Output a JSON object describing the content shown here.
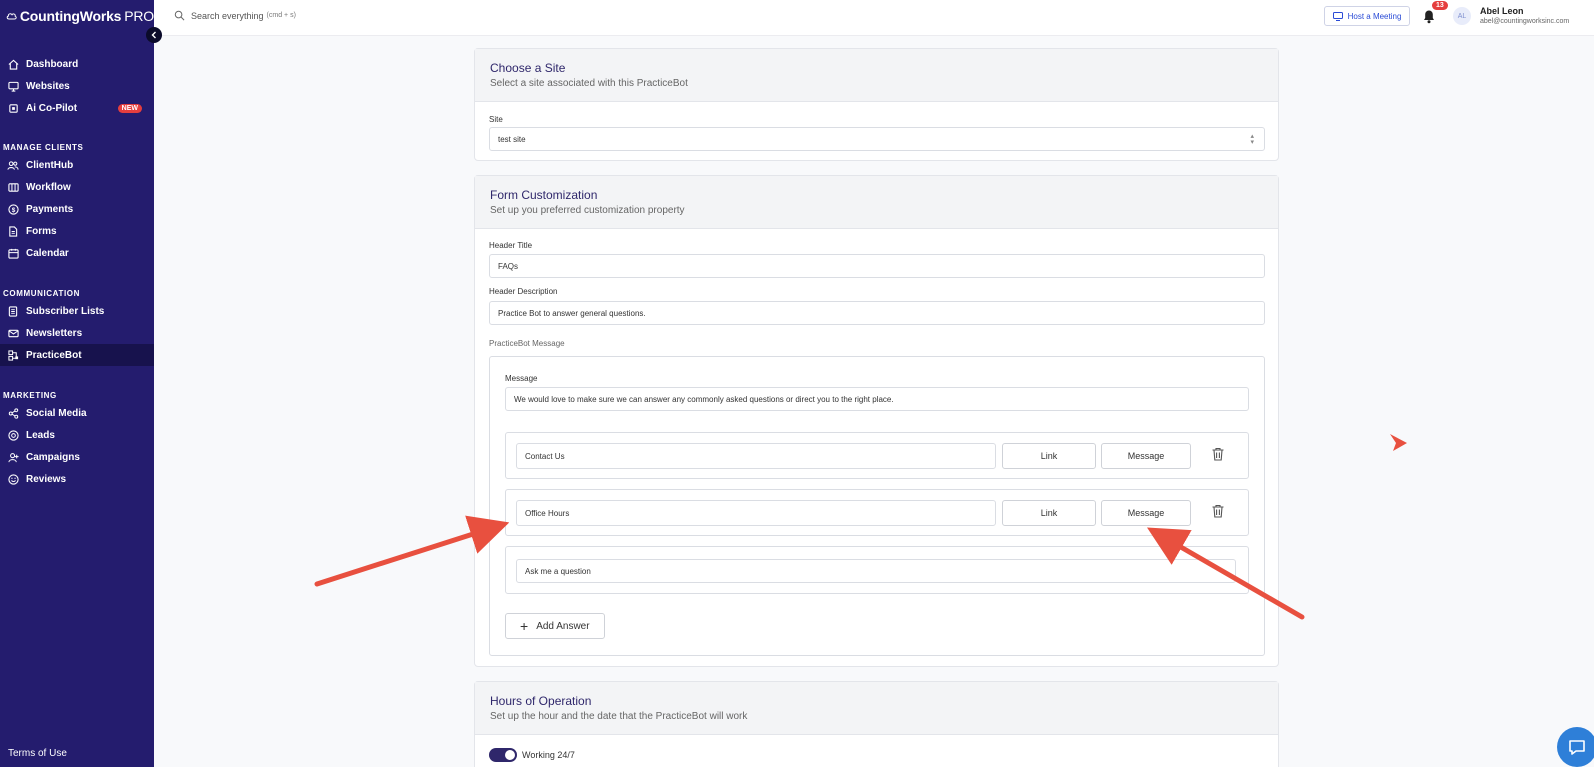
{
  "brand": {
    "name": "CountingWorks",
    "suffix": "PRO"
  },
  "sidebar": {
    "main": [
      {
        "label": "Dashboard",
        "icon": "home-icon"
      },
      {
        "label": "Websites",
        "icon": "monitor-icon"
      },
      {
        "label": "Ai Co-Pilot",
        "icon": "chip-icon",
        "badge": "NEW"
      }
    ],
    "sections": {
      "manage": "MANAGE CLIENTS",
      "communication": "COMMUNICATION",
      "marketing": "MARKETING"
    },
    "manage_items": [
      {
        "label": "ClientHub",
        "icon": "users-icon"
      },
      {
        "label": "Workflow",
        "icon": "columns-icon"
      },
      {
        "label": "Payments",
        "icon": "dollar-icon"
      },
      {
        "label": "Forms",
        "icon": "document-icon"
      },
      {
        "label": "Calendar",
        "icon": "calendar-icon"
      }
    ],
    "communication_items": [
      {
        "label": "Subscriber Lists",
        "icon": "list-icon"
      },
      {
        "label": "Newsletters",
        "icon": "mail-icon"
      },
      {
        "label": "PracticeBot",
        "icon": "bot-icon",
        "active": true
      }
    ],
    "marketing_items": [
      {
        "label": "Social Media",
        "icon": "share-icon"
      },
      {
        "label": "Leads",
        "icon": "at-icon"
      },
      {
        "label": "Campaigns",
        "icon": "user-plus-icon"
      },
      {
        "label": "Reviews",
        "icon": "smile-icon"
      }
    ],
    "footer": "Terms of Use"
  },
  "topbar": {
    "search_text": "Search everything",
    "search_hint": "(cmd + s)",
    "host_meeting": "Host a Meeting",
    "notification_count": "13",
    "avatar_initials": "AL",
    "user_name": "Abel Leon",
    "user_email": "abel@countingworksinc.com"
  },
  "site_card": {
    "title": "Choose a Site",
    "subtitle": "Select a site associated with this PracticeBot",
    "site_label": "Site",
    "site_value": "test site"
  },
  "form_card": {
    "title": "Form Customization",
    "subtitle": "Set up you preferred customization property",
    "header_title_label": "Header Title",
    "header_title_value": "FAQs",
    "header_desc_label": "Header Description",
    "header_desc_value": "Practice Bot to answer general questions.",
    "bot_message_label": "PracticeBot Message",
    "message_label": "Message",
    "message_value": "We would love to make sure we can answer any commonly asked questions or direct you to the right place.",
    "answers": [
      {
        "value": "Contact Us",
        "link": "Link",
        "message": "Message"
      },
      {
        "value": "Office Hours",
        "link": "Link",
        "message": "Message"
      }
    ],
    "ask_placeholder": "Ask me a question",
    "add_answer": "Add Answer"
  },
  "hours_card": {
    "title": "Hours of Operation",
    "subtitle": "Set up the hour and the date that the PracticeBot will work",
    "toggle_label": "Working 24/7",
    "toggle_on": true
  },
  "colors": {
    "sidebar_bg": "#241c6e",
    "accent": "#2f276b",
    "annotation_arrow": "#e8503f",
    "badge": "#e53e3e"
  }
}
